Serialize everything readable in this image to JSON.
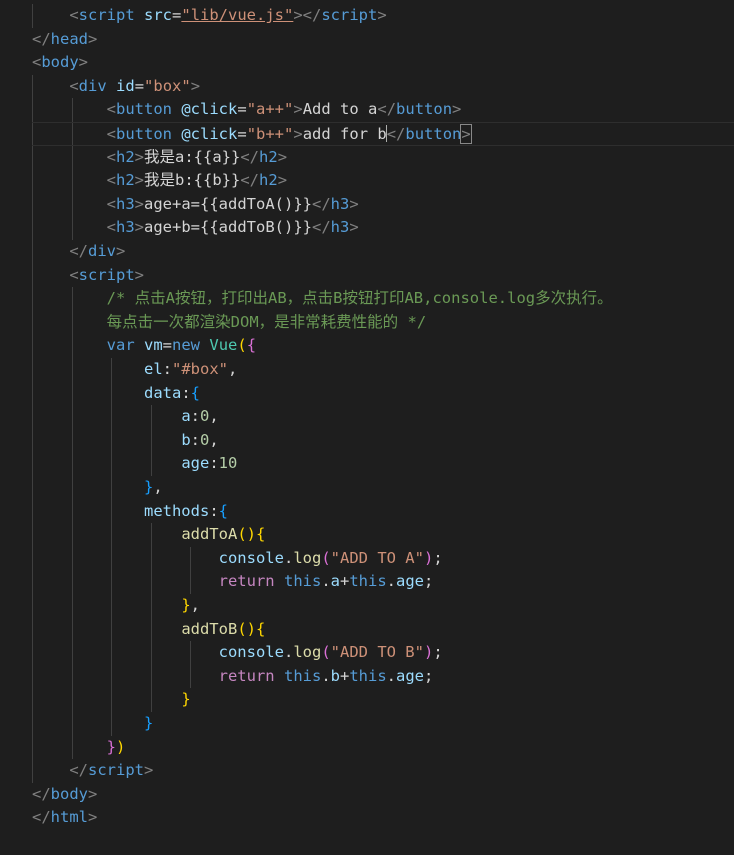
{
  "colors": {
    "background": "#1e1e1e",
    "tag_bracket": "#808080",
    "tag": "#569cd6",
    "attr": "#9cdcfe",
    "string": "#ce9178",
    "text": "#d4d4d4",
    "comment": "#6a9955",
    "keyword": "#569cd6",
    "control": "#c586c0",
    "function": "#dcdcaa",
    "class": "#4ec9b0",
    "number": "#b5cea8",
    "variable": "#9cdcfe",
    "bracket_gold": "#ffd700",
    "bracket_purple": "#da70d6",
    "bracket_blue": "#179fff",
    "guide": "#404040"
  },
  "lines": [
    {
      "tokens": [
        [
          "    ",
          "text"
        ],
        [
          "<",
          "tag_bracket"
        ],
        [
          "script",
          "tag"
        ],
        [
          " ",
          "text"
        ],
        [
          "src",
          "attr"
        ],
        [
          "=",
          "text"
        ],
        [
          "\"lib/vue.js\"",
          "string"
        ],
        [
          "></",
          "tag_bracket"
        ],
        [
          "script",
          "tag"
        ],
        [
          ">",
          "tag_bracket"
        ]
      ]
    },
    {
      "tokens": [
        [
          "</",
          "tag_bracket"
        ],
        [
          "head",
          "tag"
        ],
        [
          ">",
          "tag_bracket"
        ]
      ]
    },
    {
      "tokens": [
        [
          "<",
          "tag_bracket"
        ],
        [
          "body",
          "tag"
        ],
        [
          ">",
          "tag_bracket"
        ]
      ]
    },
    {
      "tokens": [
        [
          "    ",
          "text"
        ],
        [
          "<",
          "tag_bracket"
        ],
        [
          "div",
          "tag"
        ],
        [
          " ",
          "text"
        ],
        [
          "id",
          "attr"
        ],
        [
          "=",
          "text"
        ],
        [
          "\"box\"",
          "string"
        ],
        [
          ">",
          "tag_bracket"
        ]
      ]
    },
    {
      "tokens": [
        [
          "        ",
          "text"
        ],
        [
          "<",
          "tag_bracket"
        ],
        [
          "button",
          "tag"
        ],
        [
          " ",
          "text"
        ],
        [
          "@click",
          "attr"
        ],
        [
          "=",
          "text"
        ],
        [
          "\"a++\"",
          "string"
        ],
        [
          ">",
          "tag_bracket"
        ],
        [
          "Add to a",
          "text"
        ],
        [
          "</",
          "tag_bracket"
        ],
        [
          "button",
          "tag"
        ],
        [
          ">",
          "tag_bracket"
        ]
      ]
    },
    {
      "current": true,
      "tokens": [
        [
          "        ",
          "text"
        ],
        [
          "<",
          "tag_bracket"
        ],
        [
          "button",
          "tag"
        ],
        [
          " ",
          "text"
        ],
        [
          "@click",
          "attr"
        ],
        [
          "=",
          "text"
        ],
        [
          "\"b++\"",
          "string"
        ],
        [
          ">",
          "tag_bracket"
        ],
        [
          "add for b",
          "text"
        ],
        [
          "</",
          "tag_bracket"
        ],
        [
          "button",
          "tag"
        ],
        [
          ">",
          "tag_bracket"
        ]
      ]
    },
    {
      "tokens": [
        [
          "        ",
          "text"
        ],
        [
          "<",
          "tag_bracket"
        ],
        [
          "h2",
          "tag"
        ],
        [
          ">",
          "tag_bracket"
        ],
        [
          "我是a:{{a}}",
          "text"
        ],
        [
          "</",
          "tag_bracket"
        ],
        [
          "h2",
          "tag"
        ],
        [
          ">",
          "tag_bracket"
        ]
      ]
    },
    {
      "tokens": [
        [
          "        ",
          "text"
        ],
        [
          "<",
          "tag_bracket"
        ],
        [
          "h2",
          "tag"
        ],
        [
          ">",
          "tag_bracket"
        ],
        [
          "我是b:{{b}}",
          "text"
        ],
        [
          "</",
          "tag_bracket"
        ],
        [
          "h2",
          "tag"
        ],
        [
          ">",
          "tag_bracket"
        ]
      ]
    },
    {
      "tokens": [
        [
          "        ",
          "text"
        ],
        [
          "<",
          "tag_bracket"
        ],
        [
          "h3",
          "tag"
        ],
        [
          ">",
          "tag_bracket"
        ],
        [
          "age+a={{addToA()}}",
          "text"
        ],
        [
          "</",
          "tag_bracket"
        ],
        [
          "h3",
          "tag"
        ],
        [
          ">",
          "tag_bracket"
        ]
      ]
    },
    {
      "tokens": [
        [
          "        ",
          "text"
        ],
        [
          "<",
          "tag_bracket"
        ],
        [
          "h3",
          "tag"
        ],
        [
          ">",
          "tag_bracket"
        ],
        [
          "age+b={{addToB()}}",
          "text"
        ],
        [
          "</",
          "tag_bracket"
        ],
        [
          "h3",
          "tag"
        ],
        [
          ">",
          "tag_bracket"
        ]
      ]
    },
    {
      "tokens": [
        [
          "    ",
          "text"
        ],
        [
          "</",
          "tag_bracket"
        ],
        [
          "div",
          "tag"
        ],
        [
          ">",
          "tag_bracket"
        ]
      ]
    },
    {
      "tokens": [
        [
          "    ",
          "text"
        ],
        [
          "<",
          "tag_bracket"
        ],
        [
          "script",
          "tag"
        ],
        [
          ">",
          "tag_bracket"
        ]
      ]
    },
    {
      "tokens": [
        [
          "        ",
          "text"
        ],
        [
          "/* 点击A按钮，打印出AB，点击B按钮打印AB,console.log多次执行。",
          "comment"
        ]
      ]
    },
    {
      "tokens": [
        [
          "        ",
          "text"
        ],
        [
          "每点击一次都渲染DOM，是非常耗费性能的 */",
          "comment"
        ]
      ]
    },
    {
      "tokens": [
        [
          "        ",
          "text"
        ],
        [
          "var",
          "keyword"
        ],
        [
          " ",
          "text"
        ],
        [
          "vm",
          "variable"
        ],
        [
          "=",
          "text"
        ],
        [
          "new",
          "keyword"
        ],
        [
          " ",
          "text"
        ],
        [
          "Vue",
          "class"
        ],
        [
          "(",
          "bracket_gold"
        ],
        [
          "{",
          "bracket_purple"
        ]
      ]
    },
    {
      "tokens": [
        [
          "            ",
          "text"
        ],
        [
          "el",
          "variable"
        ],
        [
          ":",
          "text"
        ],
        [
          "\"#box\"",
          "string"
        ],
        [
          ",",
          "text"
        ]
      ]
    },
    {
      "tokens": [
        [
          "            ",
          "text"
        ],
        [
          "data",
          "variable"
        ],
        [
          ":",
          "text"
        ],
        [
          "{",
          "bracket_blue"
        ]
      ]
    },
    {
      "tokens": [
        [
          "                ",
          "text"
        ],
        [
          "a",
          "variable"
        ],
        [
          ":",
          "text"
        ],
        [
          "0",
          "number"
        ],
        [
          ",",
          "text"
        ]
      ]
    },
    {
      "tokens": [
        [
          "                ",
          "text"
        ],
        [
          "b",
          "variable"
        ],
        [
          ":",
          "text"
        ],
        [
          "0",
          "number"
        ],
        [
          ",",
          "text"
        ]
      ]
    },
    {
      "tokens": [
        [
          "                ",
          "text"
        ],
        [
          "age",
          "variable"
        ],
        [
          ":",
          "text"
        ],
        [
          "10",
          "number"
        ]
      ]
    },
    {
      "tokens": [
        [
          "            ",
          "text"
        ],
        [
          "}",
          "bracket_blue"
        ],
        [
          ",",
          "text"
        ]
      ]
    },
    {
      "tokens": [
        [
          "            ",
          "text"
        ],
        [
          "methods",
          "variable"
        ],
        [
          ":",
          "text"
        ],
        [
          "{",
          "bracket_blue"
        ]
      ]
    },
    {
      "tokens": [
        [
          "                ",
          "text"
        ],
        [
          "addToA",
          "function"
        ],
        [
          "()",
          "bracket_gold"
        ],
        [
          "{",
          "bracket_gold"
        ]
      ]
    },
    {
      "tokens": [
        [
          "                    ",
          "text"
        ],
        [
          "console",
          "variable"
        ],
        [
          ".",
          "text"
        ],
        [
          "log",
          "function"
        ],
        [
          "(",
          "bracket_purple"
        ],
        [
          "\"ADD TO A\"",
          "string"
        ],
        [
          ")",
          "bracket_purple"
        ],
        [
          ";",
          "text"
        ]
      ]
    },
    {
      "tokens": [
        [
          "                    ",
          "text"
        ],
        [
          "return",
          "control"
        ],
        [
          " ",
          "text"
        ],
        [
          "this",
          "keyword"
        ],
        [
          ".",
          "text"
        ],
        [
          "a",
          "variable"
        ],
        [
          "+",
          "text"
        ],
        [
          "this",
          "keyword"
        ],
        [
          ".",
          "text"
        ],
        [
          "age",
          "variable"
        ],
        [
          ";",
          "text"
        ]
      ]
    },
    {
      "tokens": [
        [
          "                ",
          "text"
        ],
        [
          "}",
          "bracket_gold"
        ],
        [
          ",",
          "text"
        ]
      ]
    },
    {
      "tokens": [
        [
          "                ",
          "text"
        ],
        [
          "addToB",
          "function"
        ],
        [
          "()",
          "bracket_gold"
        ],
        [
          "{",
          "bracket_gold"
        ]
      ]
    },
    {
      "tokens": [
        [
          "                    ",
          "text"
        ],
        [
          "console",
          "variable"
        ],
        [
          ".",
          "text"
        ],
        [
          "log",
          "function"
        ],
        [
          "(",
          "bracket_purple"
        ],
        [
          "\"ADD TO B\"",
          "string"
        ],
        [
          ")",
          "bracket_purple"
        ],
        [
          ";",
          "text"
        ]
      ]
    },
    {
      "tokens": [
        [
          "                    ",
          "text"
        ],
        [
          "return",
          "control"
        ],
        [
          " ",
          "text"
        ],
        [
          "this",
          "keyword"
        ],
        [
          ".",
          "text"
        ],
        [
          "b",
          "variable"
        ],
        [
          "+",
          "text"
        ],
        [
          "this",
          "keyword"
        ],
        [
          ".",
          "text"
        ],
        [
          "age",
          "variable"
        ],
        [
          ";",
          "text"
        ]
      ]
    },
    {
      "tokens": [
        [
          "                ",
          "text"
        ],
        [
          "}",
          "bracket_gold"
        ]
      ]
    },
    {
      "tokens": [
        [
          "            ",
          "text"
        ],
        [
          "}",
          "bracket_blue"
        ]
      ]
    },
    {
      "tokens": [
        [
          "        ",
          "text"
        ],
        [
          "}",
          "bracket_purple"
        ],
        [
          ")",
          "bracket_gold"
        ]
      ]
    },
    {
      "tokens": [
        [
          "    ",
          "text"
        ],
        [
          "</",
          "tag_bracket"
        ],
        [
          "script",
          "tag"
        ],
        [
          ">",
          "tag_bracket"
        ]
      ]
    },
    {
      "tokens": [
        [
          "</",
          "tag_bracket"
        ],
        [
          "body",
          "tag"
        ],
        [
          ">",
          "tag_bracket"
        ]
      ]
    },
    {
      "tokens": [
        [
          "</",
          "tag_bracket"
        ],
        [
          "html",
          "tag"
        ],
        [
          ">",
          "tag_bracket"
        ]
      ]
    }
  ]
}
